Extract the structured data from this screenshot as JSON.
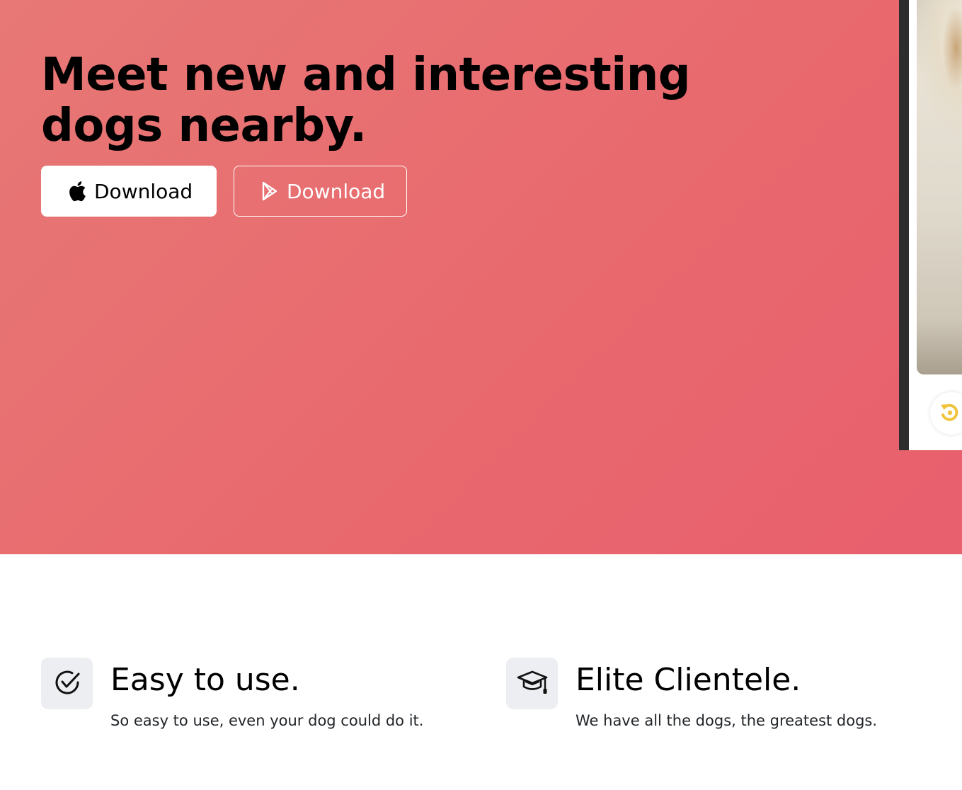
{
  "hero": {
    "title": "Meet new and interesting dogs nearby.",
    "background_colors": [
      "#e77875",
      "#e85f6d"
    ],
    "buttons": {
      "app_store_label": "Download",
      "play_store_label": "Download"
    },
    "icons": {
      "app_store": "apple-icon",
      "play_store": "google-play-icon",
      "undo": "undo-icon"
    },
    "undo_color": "#f0c43c"
  },
  "features": [
    {
      "icon": "check-circle-icon",
      "title": "Easy to use.",
      "text": "So easy to use, even your dog could do it."
    },
    {
      "icon": "graduation-cap-icon",
      "title": "Elite Clientele.",
      "text": "We have all the dogs, the greatest dogs."
    }
  ]
}
